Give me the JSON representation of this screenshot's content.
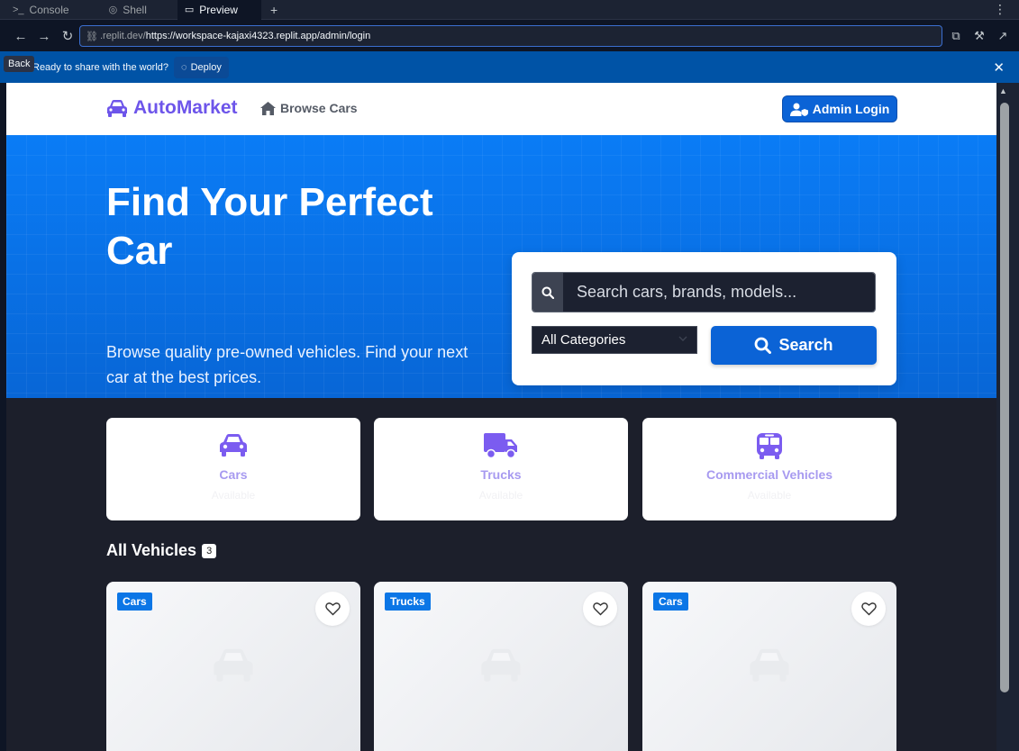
{
  "ide": {
    "tabs": [
      {
        "label": "Console",
        "icon": "terminal-icon"
      },
      {
        "label": "Shell",
        "icon": "shell-icon"
      },
      {
        "label": "Preview",
        "icon": "monitor-icon"
      }
    ],
    "add_tab": "+",
    "url_prefix": ".replit.dev/",
    "url": "https://workspace-kajaxi4323.replit.app/admin/login",
    "back_tooltip": "Back",
    "deploy_prompt": "Ready to share with the world?",
    "deploy_label": "Deploy"
  },
  "site": {
    "brand": "AutoMarket",
    "nav_browse": "Browse Cars",
    "admin_login": "Admin Login",
    "hero_title": "Find Your Perfect Car",
    "hero_subtitle": "Browse quality pre-owned vehicles. Find your next car at the best prices.",
    "search_placeholder": "Search cars, brands, models...",
    "category_selected": "All Categories",
    "search_button": "Search",
    "categories": [
      {
        "name": "Cars",
        "sub": "Available",
        "icon": "car-icon"
      },
      {
        "name": "Trucks",
        "sub": "Available",
        "icon": "truck-icon"
      },
      {
        "name": "Commercial Vehicles",
        "sub": "Available",
        "icon": "bus-icon"
      }
    ],
    "section_title": "All Vehicles",
    "vehicle_count": "3",
    "vehicles": [
      {
        "category": "Cars"
      },
      {
        "category": "Trucks"
      },
      {
        "category": "Cars"
      }
    ]
  },
  "colors": {
    "brand": "#6d55ea",
    "primary": "#0b63d6",
    "hero": "#0a7cf6",
    "page_bg": "#1c1f2b"
  }
}
